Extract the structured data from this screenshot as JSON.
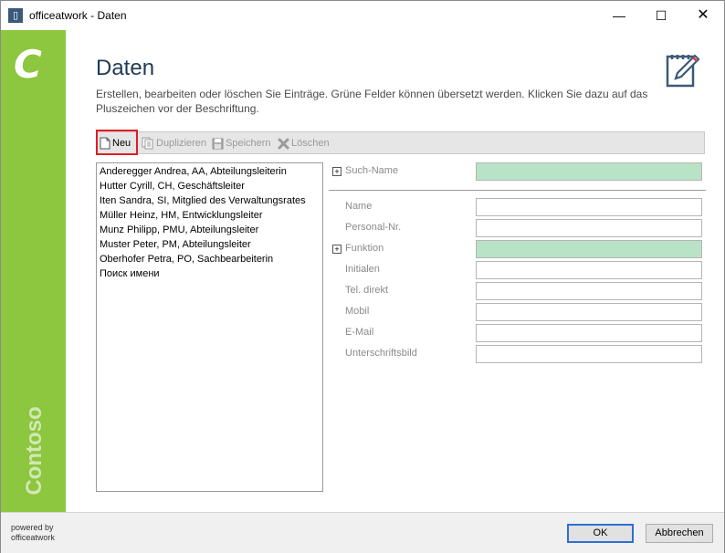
{
  "window": {
    "title": "officeatwork - Daten",
    "icon": "document-icon",
    "controls": {
      "minimize": "—",
      "maximize": "☐",
      "close": "✕"
    }
  },
  "sidebar": {
    "logo_letter": "C",
    "brand": "Contoso",
    "color": "#8dc63f"
  },
  "header": {
    "title": "Daten",
    "description": "Erstellen, bearbeiten oder löschen Sie Einträge. Grüne Felder können übersetzt werden. Klicken Sie dazu auf das Pluszeichen vor der Beschriftung."
  },
  "toolbar": {
    "new_label": "Neu",
    "duplicate_label": "Duplizieren",
    "save_label": "Speichern",
    "delete_label": "Löschen"
  },
  "list": {
    "items": [
      "Anderegger Andrea, AA, Abteilungsleiterin",
      "Hutter Cyrill, CH, Geschäftsleiter",
      "Iten Sandra, SI, Mitglied des Verwaltungsrates",
      "Müller Heinz, HM, Entwicklungsleiter",
      "Munz Philipp, PMU, Abteilungsleiter",
      "Muster Peter, PM, Abteilungsleiter",
      "Oberhofer Petra, PO, Sachbearbeiterin",
      "Поиск имени"
    ]
  },
  "form": {
    "search_name_label": "Such-Name",
    "fields": [
      {
        "label": "Name",
        "value": "",
        "translatable": false
      },
      {
        "label": "Personal-Nr.",
        "value": "",
        "translatable": false
      },
      {
        "label": "Funktion",
        "value": "",
        "translatable": true
      },
      {
        "label": "Initialen",
        "value": "",
        "translatable": false
      },
      {
        "label": "Tel. direkt",
        "value": "",
        "translatable": false
      },
      {
        "label": "Mobil",
        "value": "",
        "translatable": false
      },
      {
        "label": "E-Mail",
        "value": "",
        "translatable": false
      },
      {
        "label": "Unterschriftsbild",
        "value": "",
        "translatable": false
      }
    ],
    "translatable_color": "#b9e3c6"
  },
  "footer": {
    "powered_line1": "powered by",
    "powered_line2": "officeatwork",
    "ok_label": "OK",
    "cancel_label": "Abbrechen"
  }
}
